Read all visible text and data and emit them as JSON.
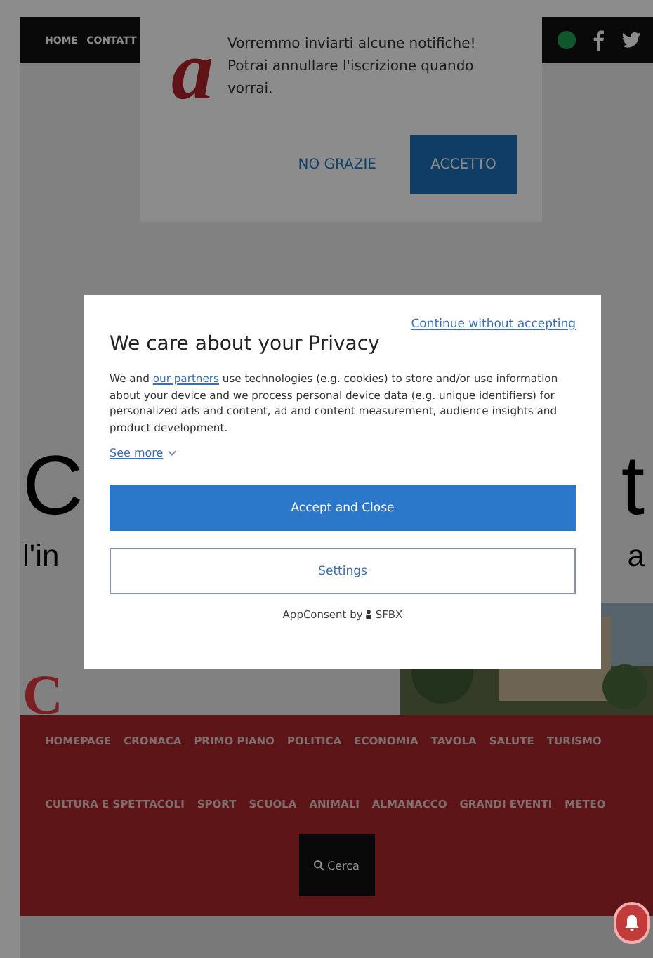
{
  "top_bar": {
    "links": [
      "HOME",
      "CONTATT"
    ]
  },
  "notification_prompt": {
    "logo_letter": "a",
    "message": "Vorremmo inviarti alcune notifiche! Potrai annullare l'iscrizione quando vorrai.",
    "buttons": [
      {
        "label": "NO GRAZIE",
        "kind": "text"
      },
      {
        "label": "ACCETTO",
        "kind": "primary"
      }
    ]
  },
  "headline": {
    "left": "C",
    "right": "t",
    "subtitle_left": "l'in",
    "subtitle_right": "a",
    "logo_letter": "C"
  },
  "nav": {
    "items": [
      "HOMEPAGE",
      "CRONACA",
      "PRIMO PIANO",
      "POLITICA",
      "ECONOMIA",
      "TAVOLA",
      "SALUTE",
      "TURISMO",
      "CULTURA E SPETTACOLI",
      "SPORT",
      "SCUOLA",
      "ANIMALI",
      "ALMANACCO",
      "GRANDI EVENTI",
      "METEO"
    ],
    "search_button": "Cerca"
  },
  "consent": {
    "continue_link": "Continue without accepting",
    "title": "We care about your Privacy",
    "body_before": "We and",
    "body_link": "our partners",
    "body_after": "use technologies (e.g. cookies) to store and/or use information about your device and we process personal device data (e.g. unique identifiers) for personalized ads and content, ad and content measurement, audience insights and product development.",
    "see_more": "See more",
    "buttons": [
      {
        "label": "Accept and Close",
        "kind": "primary"
      },
      {
        "label": "Settings",
        "kind": "outline"
      }
    ],
    "footer": "AppConsent by",
    "brand": "SFBX"
  }
}
